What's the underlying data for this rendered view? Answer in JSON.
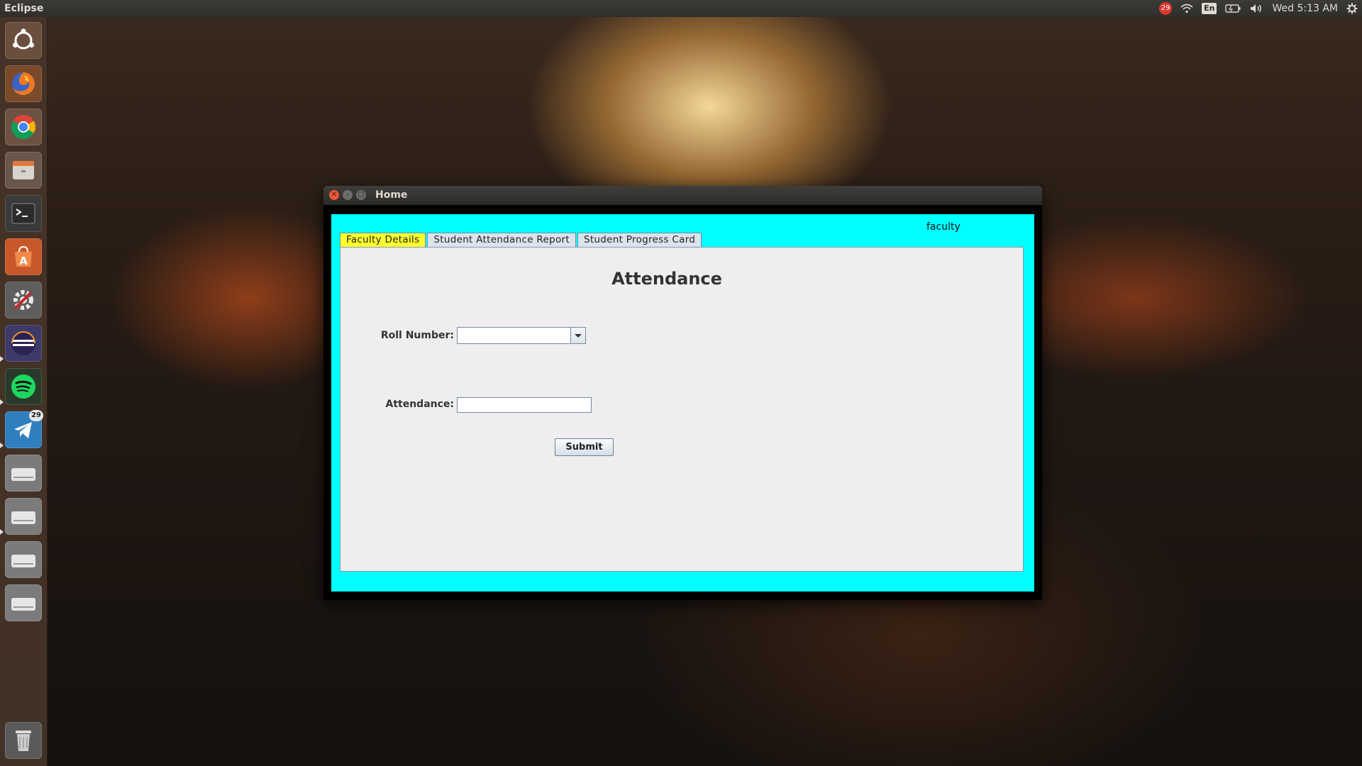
{
  "top_panel": {
    "app_name": "Eclipse",
    "notification_count": "29",
    "language": "En",
    "clock": "Wed 5:13 AM"
  },
  "launcher": {
    "items": [
      {
        "name": "Ubuntu dash",
        "icon": "ubuntu-logo-icon"
      },
      {
        "name": "Firefox",
        "icon": "firefox-icon"
      },
      {
        "name": "Google Chrome",
        "icon": "chrome-icon"
      },
      {
        "name": "Files",
        "icon": "file-manager-icon"
      },
      {
        "name": "Terminal",
        "icon": "terminal-icon"
      },
      {
        "name": "Ubuntu Software",
        "icon": "software-center-icon"
      },
      {
        "name": "System Settings",
        "icon": "settings-icon"
      },
      {
        "name": "Eclipse",
        "icon": "eclipse-icon"
      },
      {
        "name": "Spotify",
        "icon": "spotify-icon"
      },
      {
        "name": "Telegram",
        "icon": "telegram-icon",
        "badge": "29"
      },
      {
        "name": "Drive 1",
        "icon": "drive-icon"
      },
      {
        "name": "Drive 2",
        "icon": "drive-icon"
      },
      {
        "name": "Drive 3",
        "icon": "drive-icon"
      },
      {
        "name": "Drive 4",
        "icon": "drive-icon"
      },
      {
        "name": "Trash",
        "icon": "trash-icon"
      }
    ]
  },
  "window": {
    "title": "Home",
    "user_label": "faculty",
    "tabs": [
      {
        "label": "Faculty Details",
        "selected": true
      },
      {
        "label": "Student Attendance Report",
        "selected": false
      },
      {
        "label": "Student Progress Card",
        "selected": false
      }
    ],
    "form": {
      "heading": "Attendance",
      "roll_number_label": "Roll Number:",
      "roll_number_value": "",
      "attendance_label": "Attendance:",
      "attendance_value": "",
      "submit_label": "Submit"
    }
  },
  "colors": {
    "content_background": "#00ffff",
    "selected_tab": "#ffff2e",
    "panel_background": "#eeeeee"
  }
}
